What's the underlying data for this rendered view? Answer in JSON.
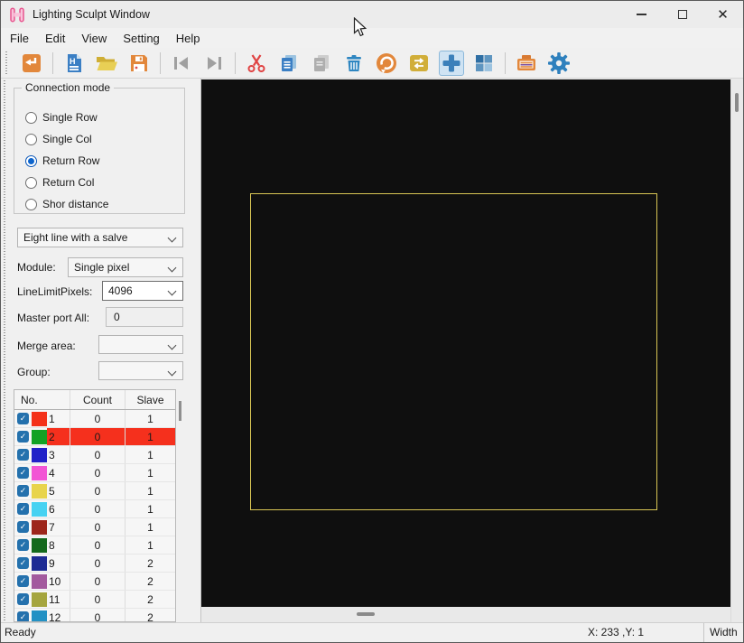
{
  "window": {
    "title": "Lighting Sculpt Window",
    "controls": [
      "minimize",
      "maximize",
      "close"
    ]
  },
  "menu": [
    "File",
    "Edit",
    "View",
    "Setting",
    "Help"
  ],
  "toolbar": {
    "buttons": [
      "import",
      "new-file",
      "open-folder",
      "save",
      "skip-first",
      "skip-last",
      "cut",
      "copy",
      "paste",
      "delete",
      "rotate",
      "swap",
      "add-pixel",
      "layout-grid",
      "test-device",
      "settings"
    ],
    "disabled": [
      "skip-first",
      "skip-last",
      "paste"
    ],
    "selected": "add-pixel"
  },
  "sidebar": {
    "connection_mode": {
      "label": "Connection mode",
      "options": [
        {
          "label": "Single Row",
          "selected": false
        },
        {
          "label": "Single Col",
          "selected": false
        },
        {
          "label": "Return Row",
          "selected": true
        },
        {
          "label": "Return Col",
          "selected": false
        },
        {
          "label": "Shor distance",
          "selected": false
        }
      ]
    },
    "line_mode_select": {
      "value": "Eight line with a salve"
    },
    "module": {
      "label": "Module:",
      "value": "Single pixel"
    },
    "line_limit_pixels": {
      "label": "LineLimitPixels:",
      "value": "4096"
    },
    "master_port_all": {
      "label": "Master port All:",
      "value": "0"
    },
    "merge_area": {
      "label": "Merge area:",
      "value": ""
    },
    "group": {
      "label": "Group:",
      "value": ""
    },
    "port_table": {
      "columns": [
        "No.",
        "Count",
        "Slave"
      ],
      "selected_row_no": "2",
      "selection_color": "#f5301d",
      "rows": [
        {
          "no": "1",
          "checked": true,
          "color": "#f43119",
          "count": "0",
          "slave": "1"
        },
        {
          "no": "2",
          "checked": true,
          "color": "#12a224",
          "count": "0",
          "slave": "1"
        },
        {
          "no": "3",
          "checked": true,
          "color": "#2121c8",
          "count": "0",
          "slave": "1"
        },
        {
          "no": "4",
          "checked": true,
          "color": "#f255d5",
          "count": "0",
          "slave": "1"
        },
        {
          "no": "5",
          "checked": true,
          "color": "#e8d44c",
          "count": "0",
          "slave": "1"
        },
        {
          "no": "6",
          "checked": true,
          "color": "#46d2f2",
          "count": "0",
          "slave": "1"
        },
        {
          "no": "7",
          "checked": true,
          "color": "#9d261b",
          "count": "0",
          "slave": "1"
        },
        {
          "no": "8",
          "checked": true,
          "color": "#14691d",
          "count": "0",
          "slave": "1"
        },
        {
          "no": "9",
          "checked": true,
          "color": "#1e2b94",
          "count": "0",
          "slave": "2"
        },
        {
          "no": "10",
          "checked": true,
          "color": "#a35a9e",
          "count": "0",
          "slave": "2"
        },
        {
          "no": "11",
          "checked": true,
          "color": "#a5a53e",
          "count": "0",
          "slave": "2"
        },
        {
          "no": "12",
          "checked": true,
          "color": "#2391c4",
          "count": "0",
          "slave": "2"
        }
      ]
    }
  },
  "canvas": {
    "background": "#0f0f0f",
    "outline_color": "#d9c654"
  },
  "statusbar": {
    "ready": "Ready",
    "coords": "X: 233 ,Y: 1",
    "width_label": "Width"
  },
  "colors": {
    "accent_blue": "#2e80bd",
    "toolbar_orange": "#e2873b",
    "selection_red": "#f5301d"
  }
}
